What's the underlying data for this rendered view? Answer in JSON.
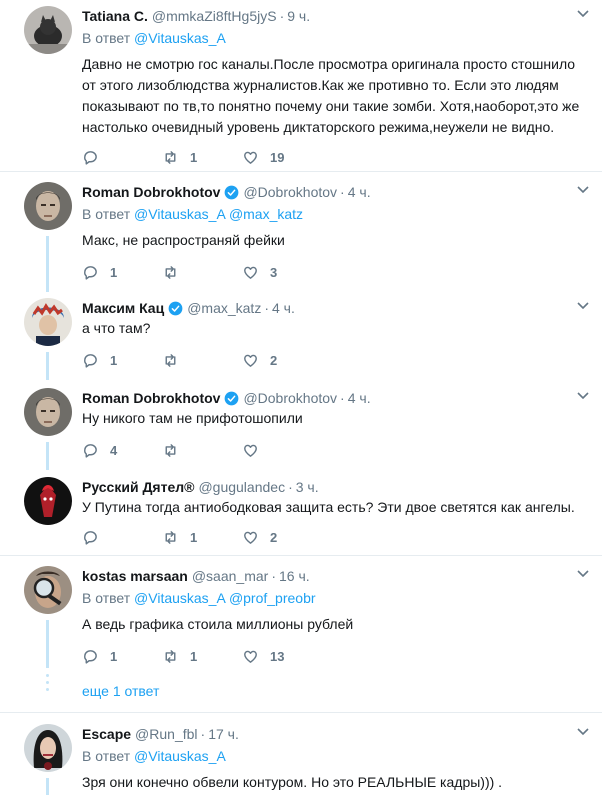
{
  "reply_prefix": "В ответ",
  "tweets": [
    {
      "name": "Tatiana C.",
      "handle": "@mmkaZi8ftHg5jyS",
      "time": "9 ч.",
      "verified": false,
      "mentions": [
        "@Vitauskas_A"
      ],
      "text": "Давно не смотрю гос каналы.После просмотра оригинала просто стошнило от этого лизоблюдства журналистов.Как же противно то. Если это людям показывают по тв,то понятно почему они такие зомби. Хотя,наоборот,это же настолько очевидный уровень диктаторского режима,неужели не видно.",
      "replies": "",
      "retweets": "1",
      "likes": "19",
      "avatar_icon": "cat-avatar"
    },
    {
      "name": "Roman Dobrokhotov",
      "handle": "@Dobrokhotov",
      "time": "4 ч.",
      "verified": true,
      "mentions": [
        "@Vitauskas_A",
        "@max_katz"
      ],
      "text": "Макс, не распространяй фейки",
      "replies": "1",
      "retweets": "",
      "likes": "3",
      "avatar_icon": "man-portrait-avatar"
    },
    {
      "name": "Максим Кац",
      "handle": "@max_katz",
      "time": "4 ч.",
      "verified": true,
      "mentions": [],
      "text": "а что там?",
      "replies": "1",
      "retweets": "",
      "likes": "2",
      "avatar_icon": "man-cartoon-avatar"
    },
    {
      "name": "Roman Dobrokhotov",
      "handle": "@Dobrokhotov",
      "time": "4 ч.",
      "verified": true,
      "mentions": [],
      "text": "Ну никого там не прифотошопили",
      "replies": "4",
      "retweets": "",
      "likes": "",
      "avatar_icon": "man-portrait-avatar"
    },
    {
      "name": "Русский Дятел®",
      "handle": "@gugulandec",
      "time": "3 ч.",
      "verified": false,
      "mentions": [],
      "text": "У Путина тогда антиободковая защита есть? Эти двое светятся как ангелы.",
      "replies": "",
      "retweets": "1",
      "likes": "2",
      "avatar_icon": "woodpecker-avatar"
    },
    {
      "name": "kostas marsaan",
      "handle": "@saan_mar",
      "time": "16 ч.",
      "verified": false,
      "mentions": [
        "@Vitauskas_A",
        "@prof_preobr"
      ],
      "text": "А ведь графика стоила миллионы рублей",
      "replies": "1",
      "retweets": "1",
      "likes": "13",
      "avatar_icon": "magnifier-avatar"
    },
    {
      "name": "Escape",
      "handle": "@Run_fbl",
      "time": "17 ч.",
      "verified": false,
      "mentions": [
        "@Vitauskas_A"
      ],
      "text": "Зря они конечно обвели контуром. Но это РЕАЛЬНЫЕ кадры))) .",
      "replies": "",
      "retweets": "",
      "likes": "",
      "avatar_icon": "woman-avatar"
    }
  ],
  "more_replies": "еще 1 ответ",
  "colors": {
    "link": "#1da1f2",
    "muted": "#657786",
    "thread": "#c4e4f7",
    "verified": "#1da1f2"
  }
}
